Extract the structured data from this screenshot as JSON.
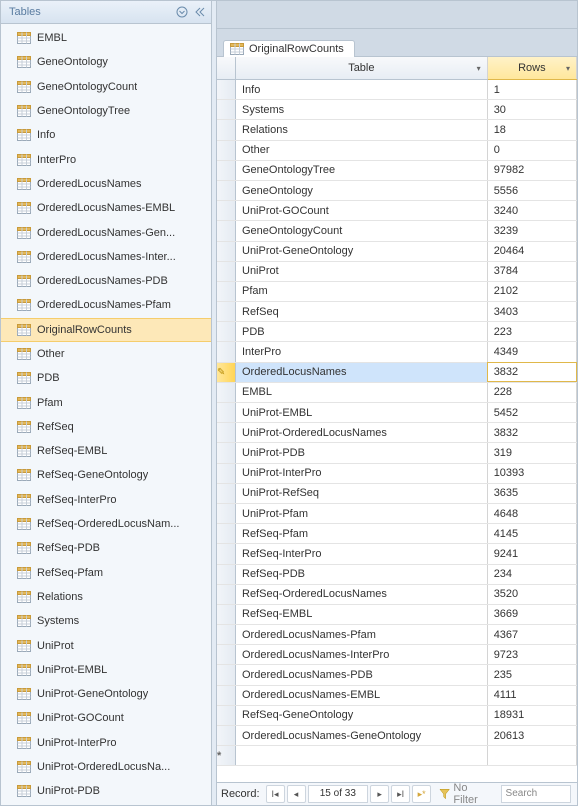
{
  "sidebar": {
    "title": "Tables",
    "items": [
      {
        "label": "EMBL"
      },
      {
        "label": "GeneOntology"
      },
      {
        "label": "GeneOntologyCount"
      },
      {
        "label": "GeneOntologyTree"
      },
      {
        "label": "Info"
      },
      {
        "label": "InterPro"
      },
      {
        "label": "OrderedLocusNames"
      },
      {
        "label": "OrderedLocusNames-EMBL"
      },
      {
        "label": "OrderedLocusNames-Gen..."
      },
      {
        "label": "OrderedLocusNames-Inter..."
      },
      {
        "label": "OrderedLocusNames-PDB"
      },
      {
        "label": "OrderedLocusNames-Pfam"
      },
      {
        "label": "OriginalRowCounts",
        "selected": true
      },
      {
        "label": "Other"
      },
      {
        "label": "PDB"
      },
      {
        "label": "Pfam"
      },
      {
        "label": "RefSeq"
      },
      {
        "label": "RefSeq-EMBL"
      },
      {
        "label": "RefSeq-GeneOntology"
      },
      {
        "label": "RefSeq-InterPro"
      },
      {
        "label": "RefSeq-OrderedLocusNam..."
      },
      {
        "label": "RefSeq-PDB"
      },
      {
        "label": "RefSeq-Pfam"
      },
      {
        "label": "Relations"
      },
      {
        "label": "Systems"
      },
      {
        "label": "UniProt"
      },
      {
        "label": "UniProt-EMBL"
      },
      {
        "label": "UniProt-GeneOntology"
      },
      {
        "label": "UniProt-GOCount"
      },
      {
        "label": "UniProt-InterPro"
      },
      {
        "label": "UniProt-OrderedLocusNa..."
      },
      {
        "label": "UniProt-PDB"
      }
    ]
  },
  "tab": {
    "title": "OriginalRowCounts"
  },
  "grid": {
    "columns": [
      "Table",
      "Rows"
    ],
    "selected_index": 14,
    "rows": [
      {
        "table": "Info",
        "rows": "1"
      },
      {
        "table": "Systems",
        "rows": "30"
      },
      {
        "table": "Relations",
        "rows": "18"
      },
      {
        "table": "Other",
        "rows": "0"
      },
      {
        "table": "GeneOntologyTree",
        "rows": "97982"
      },
      {
        "table": "GeneOntology",
        "rows": "5556"
      },
      {
        "table": "UniProt-GOCount",
        "rows": "3240"
      },
      {
        "table": "GeneOntologyCount",
        "rows": "3239"
      },
      {
        "table": "UniProt-GeneOntology",
        "rows": "20464"
      },
      {
        "table": "UniProt",
        "rows": "3784"
      },
      {
        "table": "Pfam",
        "rows": "2102"
      },
      {
        "table": "RefSeq",
        "rows": "3403"
      },
      {
        "table": "PDB",
        "rows": "223"
      },
      {
        "table": "InterPro",
        "rows": "4349"
      },
      {
        "table": "OrderedLocusNames",
        "rows": "3832"
      },
      {
        "table": "EMBL",
        "rows": "228"
      },
      {
        "table": "UniProt-EMBL",
        "rows": "5452"
      },
      {
        "table": "UniProt-OrderedLocusNames",
        "rows": "3832"
      },
      {
        "table": "UniProt-PDB",
        "rows": "319"
      },
      {
        "table": "UniProt-InterPro",
        "rows": "10393"
      },
      {
        "table": "UniProt-RefSeq",
        "rows": "3635"
      },
      {
        "table": "UniProt-Pfam",
        "rows": "4648"
      },
      {
        "table": "RefSeq-Pfam",
        "rows": "4145"
      },
      {
        "table": "RefSeq-InterPro",
        "rows": "9241"
      },
      {
        "table": "RefSeq-PDB",
        "rows": "234"
      },
      {
        "table": "RefSeq-OrderedLocusNames",
        "rows": "3520"
      },
      {
        "table": "RefSeq-EMBL",
        "rows": "3669"
      },
      {
        "table": "OrderedLocusNames-Pfam",
        "rows": "4367"
      },
      {
        "table": "OrderedLocusNames-InterPro",
        "rows": "9723"
      },
      {
        "table": "OrderedLocusNames-PDB",
        "rows": "235"
      },
      {
        "table": "OrderedLocusNames-EMBL",
        "rows": "4111"
      },
      {
        "table": "RefSeq-GeneOntology",
        "rows": "18931"
      },
      {
        "table": "OrderedLocusNames-GeneOntology",
        "rows": "20613"
      }
    ]
  },
  "nav": {
    "label": "Record:",
    "current": "15 of 33",
    "filter_label": "No Filter",
    "search_placeholder": "Search"
  }
}
